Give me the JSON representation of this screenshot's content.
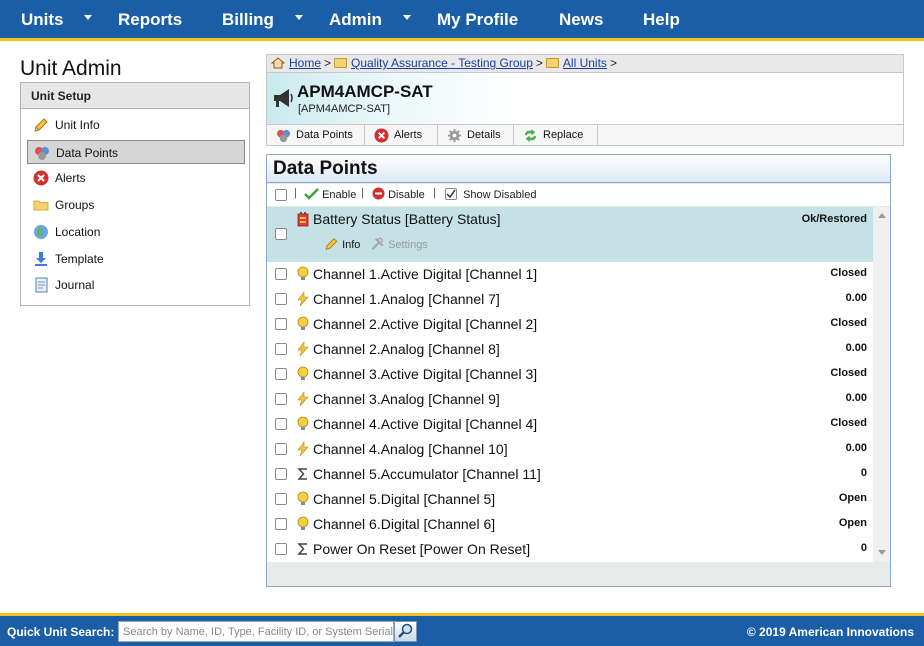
{
  "nav": {
    "items": [
      {
        "label": "Units",
        "has_dropdown": true
      },
      {
        "label": "Reports",
        "has_dropdown": false
      },
      {
        "label": "Billing",
        "has_dropdown": true
      },
      {
        "label": "Admin",
        "has_dropdown": true
      },
      {
        "label": "My Profile",
        "has_dropdown": false
      },
      {
        "label": "News",
        "has_dropdown": false
      },
      {
        "label": "Help",
        "has_dropdown": false
      }
    ]
  },
  "left": {
    "title": "Unit Admin",
    "section_header": "Unit Setup",
    "items": [
      {
        "label": "Unit Info",
        "icon": "pencil-icon"
      },
      {
        "label": "Data Points",
        "icon": "data-points-icon",
        "active": true
      },
      {
        "label": "Alerts",
        "icon": "alert-icon"
      },
      {
        "label": "Groups",
        "icon": "folder-icon"
      },
      {
        "label": "Location",
        "icon": "globe-icon"
      },
      {
        "label": "Template",
        "icon": "download-icon"
      },
      {
        "label": "Journal",
        "icon": "journal-icon"
      }
    ]
  },
  "breadcrumb": {
    "items": [
      "Home",
      "Quality Assurance - Testing Group",
      "All Units"
    ],
    "separator": ">"
  },
  "unit": {
    "name": "APM4AMCP-SAT",
    "subtitle": "[APM4AMCP-SAT]"
  },
  "subtabs": [
    {
      "label": "Data Points",
      "icon": "data-points-icon"
    },
    {
      "label": "Alerts",
      "icon": "alert-icon"
    },
    {
      "label": "Details",
      "icon": "gear-icon"
    },
    {
      "label": "Replace",
      "icon": "replace-icon"
    }
  ],
  "datapoints": {
    "title": "Data Points",
    "toolbar": {
      "enable": "Enable",
      "disable": "Disable",
      "show_disabled": "Show Disabled",
      "separator": "|"
    },
    "selected_actions": {
      "info": "Info",
      "settings": "Settings"
    },
    "rows": [
      {
        "name": "Battery Status [Battery Status]",
        "value": "Ok/Restored",
        "icon": "battery-icon"
      },
      {
        "name": "Channel 1.Active Digital [Channel 1]",
        "value": "Closed",
        "icon": "lightbulb-icon"
      },
      {
        "name": "Channel 1.Analog [Channel 7]",
        "value": "0.00",
        "icon": "lightning-icon"
      },
      {
        "name": "Channel 2.Active Digital [Channel 2]",
        "value": "Closed",
        "icon": "lightbulb-icon"
      },
      {
        "name": "Channel 2.Analog [Channel 8]",
        "value": "0.00",
        "icon": "lightning-icon"
      },
      {
        "name": "Channel 3.Active Digital [Channel 3]",
        "value": "Closed",
        "icon": "lightbulb-icon"
      },
      {
        "name": "Channel 3.Analog [Channel 9]",
        "value": "0.00",
        "icon": "lightning-icon"
      },
      {
        "name": "Channel 4.Active Digital [Channel 4]",
        "value": "Closed",
        "icon": "lightbulb-icon"
      },
      {
        "name": "Channel 4.Analog [Channel 10]",
        "value": "0.00",
        "icon": "lightning-icon"
      },
      {
        "name": "Channel 5.Accumulator [Channel 11]",
        "value": "0",
        "icon": "sigma-icon"
      },
      {
        "name": "Channel 5.Digital [Channel 5]",
        "value": "Open",
        "icon": "lightbulb-icon"
      },
      {
        "name": "Channel 6.Digital [Channel 6]",
        "value": "Open",
        "icon": "lightbulb-icon"
      },
      {
        "name": "Power On Reset [Power On Reset]",
        "value": "0",
        "icon": "sigma-icon"
      }
    ]
  },
  "footer": {
    "quick_search_label": "Quick Unit Search:",
    "quick_search_placeholder": "Search by Name, ID, Type, Facility ID, or System Serial",
    "copyright": "© 2019 American Innovations"
  },
  "colors": {
    "nav_bg": "#1b5ea8",
    "accent_yellow": "#f0c419",
    "selected_row": "#c5e1e6",
    "link": "#1b3fa0"
  }
}
